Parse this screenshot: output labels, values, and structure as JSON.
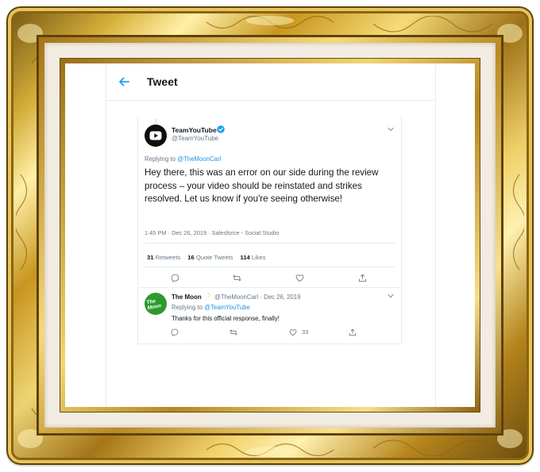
{
  "header": {
    "title": "Tweet"
  },
  "tweet": {
    "author_name": "TeamYouTube",
    "author_handle": "@TeamYouTube",
    "replying_prefix": "Replying to",
    "replying_to": "@TheMoonCarl",
    "text": "Hey there, this was an error on our side during the review process – your video should be reinstated and strikes resolved. Let us know if you're seeing otherwise!",
    "meta": "1:45 PM · Dec 26, 2019 · Salesforce - Social Studio",
    "stats": {
      "retweets_count": "31",
      "retweets_label": "Retweets",
      "quotes_count": "16",
      "quotes_label": "Quote Tweets",
      "likes_count": "114",
      "likes_label": "Likes"
    }
  },
  "reply": {
    "author_name": "The Moon",
    "author_badge_icon": "crescent-moon-icon",
    "author_handle": "@TheMoonCarl · Dec 26, 2019",
    "replying_prefix": "Replying to",
    "replying_to": "@TeamYouTube",
    "text": "Thanks for this official response, finally!",
    "like_count": "33",
    "avatar_text": "The Moon"
  },
  "colors": {
    "accent": "#1da1f2",
    "text": "#14171a",
    "muted": "#657786",
    "gold": "#d4a72c"
  }
}
